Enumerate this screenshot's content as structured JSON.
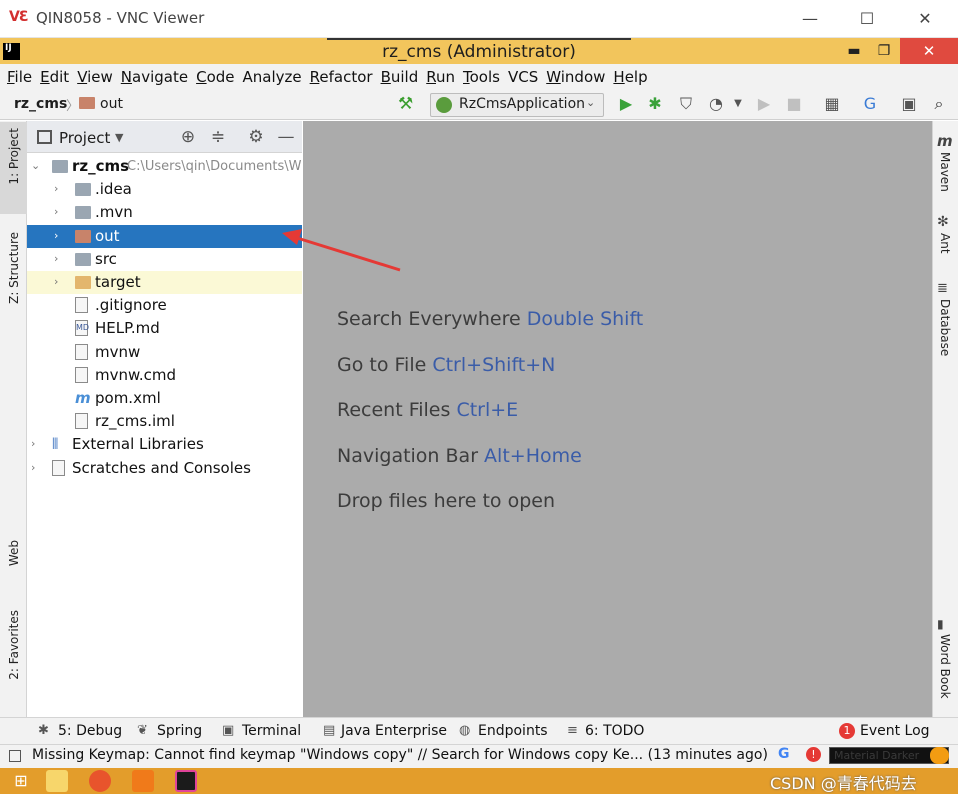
{
  "vnc": {
    "logo": "VƐ",
    "title": "QIN8058 - VNC Viewer",
    "minimize": "—",
    "maximize": "☐",
    "close": "✕"
  },
  "ide": {
    "logo": "IJ",
    "title": "rz_cms (Administrator)",
    "minimize": "▬",
    "restore": "❐",
    "close": "✕"
  },
  "menu": [
    {
      "label": "File",
      "u": "F",
      "rest": "ile"
    },
    {
      "label": "Edit",
      "u": "E",
      "rest": "dit"
    },
    {
      "label": "View",
      "u": "V",
      "rest": "iew"
    },
    {
      "label": "Navigate",
      "u": "N",
      "rest": "avigate"
    },
    {
      "label": "Code",
      "u": "C",
      "rest": "ode"
    },
    {
      "label": "Analyze",
      "u": "",
      "rest": "Analyze"
    },
    {
      "label": "Refactor",
      "u": "R",
      "rest": "efactor"
    },
    {
      "label": "Build",
      "u": "B",
      "rest": "uild"
    },
    {
      "label": "Run",
      "u": "R",
      "rest": "un"
    },
    {
      "label": "Tools",
      "u": "T",
      "rest": "ools"
    },
    {
      "label": "VCS",
      "u": "",
      "rest": "VCS"
    },
    {
      "label": "Window",
      "u": "W",
      "rest": "indow"
    },
    {
      "label": "Help",
      "u": "H",
      "rest": "elp"
    }
  ],
  "breadcrumb": {
    "root": "rz_cms",
    "sep": "〉",
    "leaf": "out"
  },
  "toolbar": {
    "run_config": "RzCmsApplication",
    "icons": [
      "hammer-icon",
      "run-icon",
      "debug-icon",
      "coverage-icon",
      "profile-icon",
      "resume-icon",
      "stop-icon",
      "project-structure-icon",
      "translate-icon",
      "terminal-window-icon",
      "search-icon"
    ]
  },
  "left_tabs": {
    "project": "1: Project",
    "structure": "Z: Structure",
    "web": "Web",
    "favorites": "2: Favorites"
  },
  "right_tabs": {
    "maven": "Maven",
    "ant": "Ant",
    "database": "Database",
    "wordbook": "Word Book"
  },
  "project_panel": {
    "title": "Project",
    "tree": [
      {
        "label": "rz_cms",
        "path": "C:\\Users\\qin\\Documents\\W",
        "kind": "root"
      },
      {
        "label": ".idea",
        "kind": "folder"
      },
      {
        "label": ".mvn",
        "kind": "folder"
      },
      {
        "label": "out",
        "kind": "folder-out"
      },
      {
        "label": "src",
        "kind": "folder"
      },
      {
        "label": "target",
        "kind": "folder-target"
      },
      {
        "label": ".gitignore",
        "kind": "file"
      },
      {
        "label": "HELP.md",
        "kind": "file",
        "badge": "MD"
      },
      {
        "label": "mvnw",
        "kind": "file"
      },
      {
        "label": "mvnw.cmd",
        "kind": "file"
      },
      {
        "label": "pom.xml",
        "kind": "maven"
      },
      {
        "label": "rz_cms.iml",
        "kind": "file"
      },
      {
        "label": "External Libraries",
        "kind": "libs"
      },
      {
        "label": "Scratches and Consoles",
        "kind": "scratch"
      }
    ]
  },
  "editor_hints": [
    {
      "text": "Search Everywhere",
      "key": "Double Shift"
    },
    {
      "text": "Go to File",
      "key": "Ctrl+Shift+N"
    },
    {
      "text": "Recent Files",
      "key": "Ctrl+E"
    },
    {
      "text": "Navigation Bar",
      "key": "Alt+Home"
    },
    {
      "text": "Drop files here to open",
      "key": ""
    }
  ],
  "bottom_tabs": {
    "debug": "5: Debug",
    "spring": "Spring",
    "terminal": "Terminal",
    "java_enterprise": "Java Enterprise",
    "endpoints": "Endpoints",
    "todo": "6: TODO",
    "event_log": "Event Log",
    "event_count": "1"
  },
  "status": {
    "message": "Missing Keymap: Cannot find keymap \"Windows copy\" // Search for Windows copy Ke... (13 minutes ago)",
    "theme": "Material Darker"
  },
  "taskbar": {
    "watermark": "CSDN @青春代码去",
    "icons": [
      "start-icon",
      "file-explorer-icon",
      "firefox-icon",
      "office-icon",
      "intellij-icon"
    ]
  },
  "colors": {
    "selection": "#2675bf",
    "ide_titlebar": "#f2c55c",
    "taskbar": "#e39d2b",
    "editor_bg": "#ababab",
    "hint_key": "#3a5ca8",
    "annotation": "#e53935"
  }
}
